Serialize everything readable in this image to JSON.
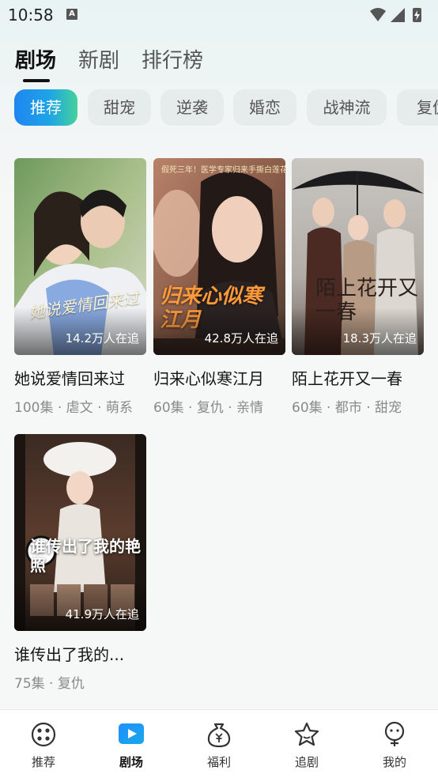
{
  "status_bar": {
    "time": "10:58",
    "notification_letter": "A"
  },
  "top_tabs": [
    {
      "label": "剧场",
      "active": true
    },
    {
      "label": "新剧",
      "active": false
    },
    {
      "label": "排行榜",
      "active": false
    }
  ],
  "chips": [
    {
      "label": "推荐",
      "active": true
    },
    {
      "label": "甜宠",
      "active": false
    },
    {
      "label": "逆袭",
      "active": false
    },
    {
      "label": "婚恋",
      "active": false
    },
    {
      "label": "战神流",
      "active": false
    },
    {
      "label": "复仇",
      "active": false
    }
  ],
  "dramas": [
    {
      "title": "她说爱情回来过",
      "meta": "100集 · 虐文 · 萌系",
      "followers": "14.2万人在追",
      "poster_text": "她说爱情回来过"
    },
    {
      "title": "归来心似寒江月",
      "meta": "60集 · 复仇 · 亲情",
      "followers": "42.8万人在追",
      "poster_text": "归来心似寒江月",
      "poster_banner": "假死三年！医学专家归来手撕白莲花"
    },
    {
      "title": "陌上花开又一春",
      "meta": "60集 · 都市 · 甜宠",
      "followers": "18.3万人在追",
      "poster_text": "陌上花开又一春"
    },
    {
      "title": "谁传出了我的...",
      "meta": "75集 · 复仇",
      "followers": "41.9万人在追",
      "poster_text": "谁传出了我的艳照"
    }
  ],
  "bottom_nav": [
    {
      "label": "推荐",
      "icon": "film-reel-icon",
      "active": false
    },
    {
      "label": "剧场",
      "icon": "play-icon",
      "active": true
    },
    {
      "label": "福利",
      "icon": "money-bag-icon",
      "active": false
    },
    {
      "label": "追剧",
      "icon": "star-icon",
      "active": false
    },
    {
      "label": "我的",
      "icon": "profile-icon",
      "active": false
    }
  ],
  "colors": {
    "accent_blue": "#1f86f0",
    "accent_green": "#44d39b",
    "nav_active": "#1e90ff"
  }
}
